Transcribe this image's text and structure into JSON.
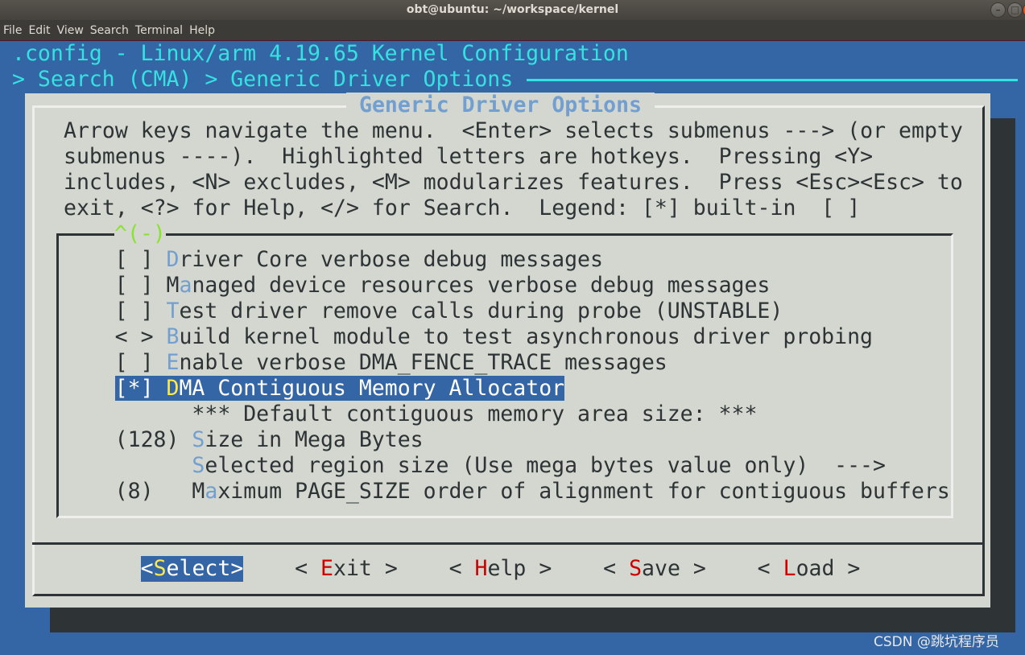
{
  "window": {
    "title": "obt@ubuntu: ~/workspace/kernel"
  },
  "menubar": [
    "File",
    "Edit",
    "View",
    "Search",
    "Terminal",
    "Help"
  ],
  "header": {
    "title": ".config - Linux/arm 4.19.65 Kernel Configuration",
    "breadcrumb": "> Search (CMA) > Generic Driver Options"
  },
  "dialog": {
    "title": "Generic Driver Options",
    "help": [
      "Arrow keys navigate the menu.  <Enter> selects submenus ---> (or empty",
      "submenus ----).  Highlighted letters are hotkeys.  Pressing <Y>",
      "includes, <N> excludes, <M> modularizes features.  Press <Esc><Esc> to",
      "exit, <?> for Help, </> for Search.  Legend: [*] built-in  [ ]"
    ],
    "scroll_indicator": "^(-)",
    "items": [
      {
        "prefix": "[ ] ",
        "pre": "",
        "hot": "D",
        "post": "river Core verbose debug messages"
      },
      {
        "prefix": "[ ] ",
        "pre": "M",
        "hot": "a",
        "post": "naged device resources verbose debug messages"
      },
      {
        "prefix": "[ ] ",
        "pre": "",
        "hot": "T",
        "post": "est driver remove calls during probe (UNSTABLE)"
      },
      {
        "prefix": "< > ",
        "pre": "",
        "hot": "B",
        "post": "uild kernel module to test asynchronous driver probing"
      },
      {
        "prefix": "[ ] ",
        "pre": "",
        "hot": "E",
        "post": "nable verbose DMA_FENCE_TRACE messages"
      },
      {
        "prefix": "[*] ",
        "pre": "",
        "hot": "D",
        "post": "MA Contiguous Memory Allocator",
        "selected": true
      },
      {
        "prefix": "      ",
        "pre": "*** Default contiguous memory area size: ***",
        "hot": "",
        "post": ""
      },
      {
        "prefix": "(128) ",
        "pre": "",
        "hot": "S",
        "post": "ize in Mega Bytes"
      },
      {
        "prefix": "      ",
        "pre": "",
        "hot": "S",
        "post": "elected region size (Use mega bytes value only)  --->"
      },
      {
        "prefix": "(8)   ",
        "pre": "M",
        "hot": "a",
        "post": "ximum PAGE_SIZE order of alignment for contiguous buffers"
      }
    ],
    "buttons": [
      {
        "l": "<",
        "hot": "S",
        "post": "elect",
        "r": ">",
        "selected": true
      },
      {
        "l": "< ",
        "hot": "E",
        "post": "xit",
        "r": " >"
      },
      {
        "l": "< ",
        "hot": "H",
        "post": "elp",
        "r": " >"
      },
      {
        "l": "< ",
        "hot": "S",
        "post": "ave",
        "r": " >"
      },
      {
        "l": "< ",
        "hot": "L",
        "post": "oad",
        "r": " >"
      }
    ]
  },
  "watermark": "CSDN @跳坑程序员"
}
